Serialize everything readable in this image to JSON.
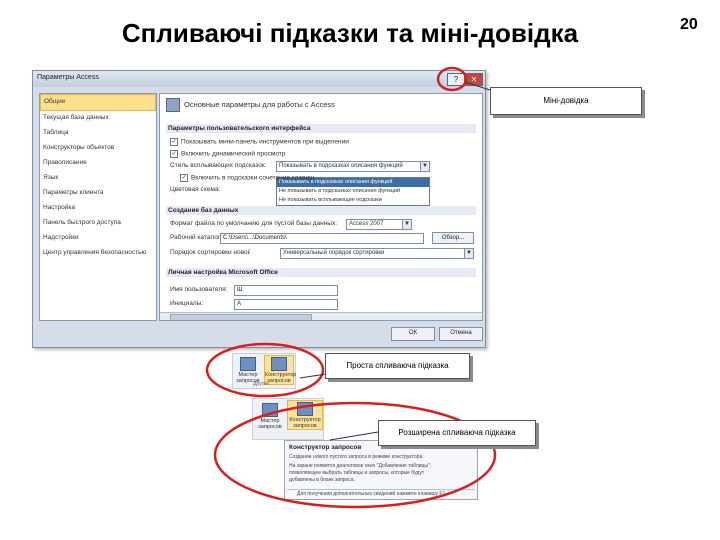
{
  "slide": {
    "title": "Спливаючі підказки та міні-довідка",
    "page_number": "20"
  },
  "dialog": {
    "title": "Параметры Access",
    "help_glyph": "?",
    "close_glyph": "✕",
    "nav_items": [
      "Общие",
      "Текущая база данных",
      "Таблица",
      "Конструкторы объектов",
      "Правописание",
      "Язык",
      "Параметры клиента",
      "Настройка",
      "Панель быстрого доступа",
      "Надстройки",
      "Центр управления безопасностью"
    ],
    "header": "Основные параметры для работы с Access",
    "section_ui": "Параметры пользовательского интерфейса",
    "option_minitoolbar": "Показывать мини-панель инструментов при выделении",
    "option_livepreview": "Включить динамический просмотр",
    "scheme_label": "Цветовая схема:",
    "tip_style_label": "Стиль всплывающих подсказок:",
    "tip_style_value": "Показывать в подсказках описания функций",
    "tip_options": [
      "Показывать в подсказках описания функций",
      "Не показывать в подсказках описания функций",
      "Не показывать всплывающие подсказки"
    ],
    "option_shortcuts": "Включить в подсказки сочетания клавиш",
    "scheme_row": "Цветовая схема:",
    "section_db": "Создание баз данных",
    "default_format_label": "Формат файла по умолчанию для пустой базы данных:",
    "default_format_value": "Access 2007",
    "default_folder_label": "Рабочий каталог:",
    "default_folder_value": "C:\\Users\\...\\Documents\\",
    "browse_label": "Обзор...",
    "sort_order_label": "Порядок сортировки новой базы данных:",
    "sort_order_value": "Универсальный порядок сортировки",
    "section_personal": "Личная настройка Microsoft Office",
    "user_name_label": "Имя пользователя:",
    "user_name_value": "Ш",
    "initials_label": "Инициалы:",
    "initials_value": "А",
    "ok_label": "ОК",
    "cancel_label": "Отмена"
  },
  "callouts": {
    "mini_help": "Міні-довідка",
    "simple_tip": "Проста спливаюча підказка",
    "extended_tip": "Розширена спливаюча підказка"
  },
  "ribbon": {
    "wizard_label": "Мастер запросов",
    "designer_label": "Конструктор запросов",
    "group_other": "Другие",
    "supertip_title": "Конструктор запросов",
    "supertip_lines": [
      "Создание нового пустого запроса в режиме конструктора.",
      "На экране появится диалоговое окно \"Добавление таблицы\",",
      "позволяющее выбрать таблицы и запросы, которые будут",
      "добавлены в бланк запроса."
    ],
    "supertip_footer": "Для получения дополнительных сведений нажмите клавишу F1."
  },
  "colors": {
    "highlight_ring": "#d62020",
    "nav_selected": "#ffe08a",
    "dialog_frame": "#d5dde8"
  }
}
